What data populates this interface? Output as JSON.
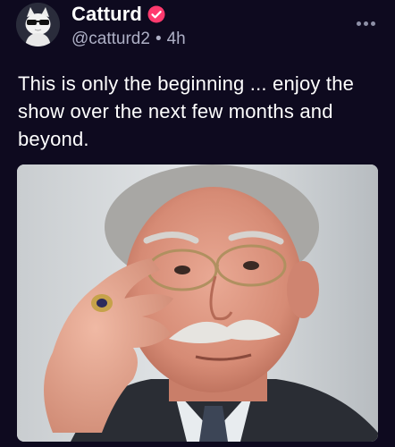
{
  "post": {
    "author": {
      "display_name": "Catturd",
      "handle": "@catturd2",
      "separator": "•",
      "time_ago": "4h",
      "verified": true,
      "avatar_icon": "cat-avatar-icon",
      "verified_icon": "verified-badge-icon"
    },
    "more_icon": "more-options-icon",
    "text": "This is only the beginning ... enjoy the show over the next few months and beyond.",
    "image": {
      "description_icon": "portrait-photo"
    }
  },
  "colors": {
    "background": "#0e0a1f",
    "verified_badge": "#ff3a6e",
    "secondary_text": "#aeb0c6"
  }
}
